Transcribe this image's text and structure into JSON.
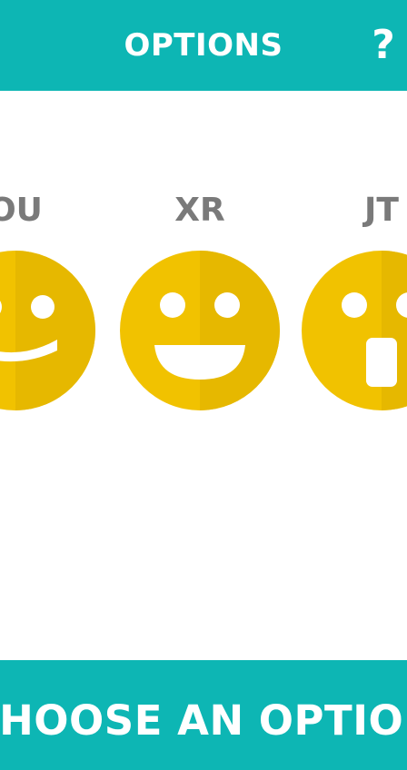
{
  "header": {
    "title": "OPTIONS",
    "help_label": "?"
  },
  "options": [
    {
      "label": "OU",
      "icon": "wink-smiley-icon"
    },
    {
      "label": "XR",
      "icon": "grin-smiley-icon"
    },
    {
      "label": "JT",
      "icon": "surprised-smiley-icon"
    }
  ],
  "footer": {
    "label": "CHOOSE AN OPTION"
  },
  "colors": {
    "accent": "#0db6b4",
    "face": "#f1c200",
    "face_shade": "#e6b800",
    "label": "#7a7a7a"
  }
}
